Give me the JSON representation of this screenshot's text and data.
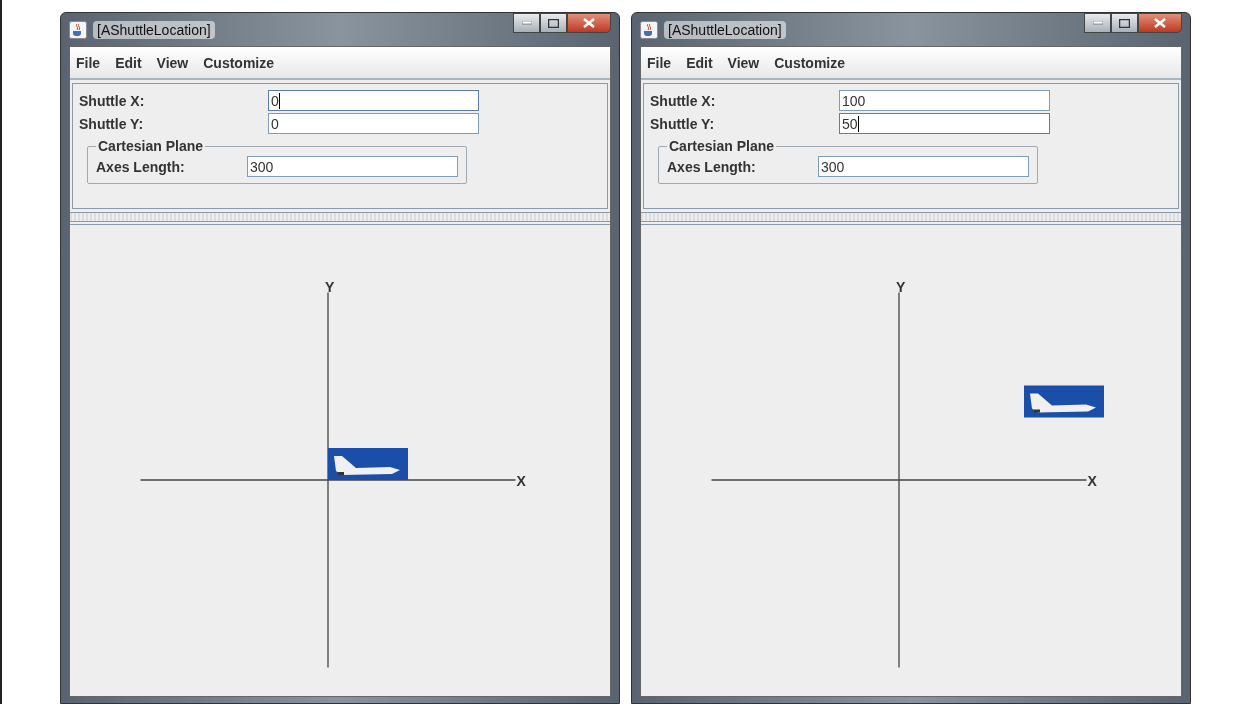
{
  "windows": [
    {
      "title": "[AShuttleLocation]",
      "menu": [
        "File",
        "Edit",
        "View",
        "Customize"
      ],
      "fields": [
        {
          "label": "Shuttle X:",
          "value": "0",
          "focused": true
        },
        {
          "label": "Shuttle Y:",
          "value": "0",
          "focused": false
        }
      ],
      "group": {
        "title": "Cartesian Plane",
        "label": "Axes Length:",
        "value": "300"
      },
      "canvas": {
        "y_label": "Y",
        "x_label": "X"
      }
    },
    {
      "title": "[AShuttleLocation]",
      "menu": [
        "File",
        "Edit",
        "View",
        "Customize"
      ],
      "fields": [
        {
          "label": "Shuttle X:",
          "value": "100",
          "focused": false
        },
        {
          "label": "Shuttle Y:",
          "value": "50",
          "focused": true
        }
      ],
      "group": {
        "title": "Cartesian Plane",
        "label": "Axes Length:",
        "value": "300"
      },
      "canvas": {
        "y_label": "Y",
        "x_label": "X"
      }
    }
  ]
}
